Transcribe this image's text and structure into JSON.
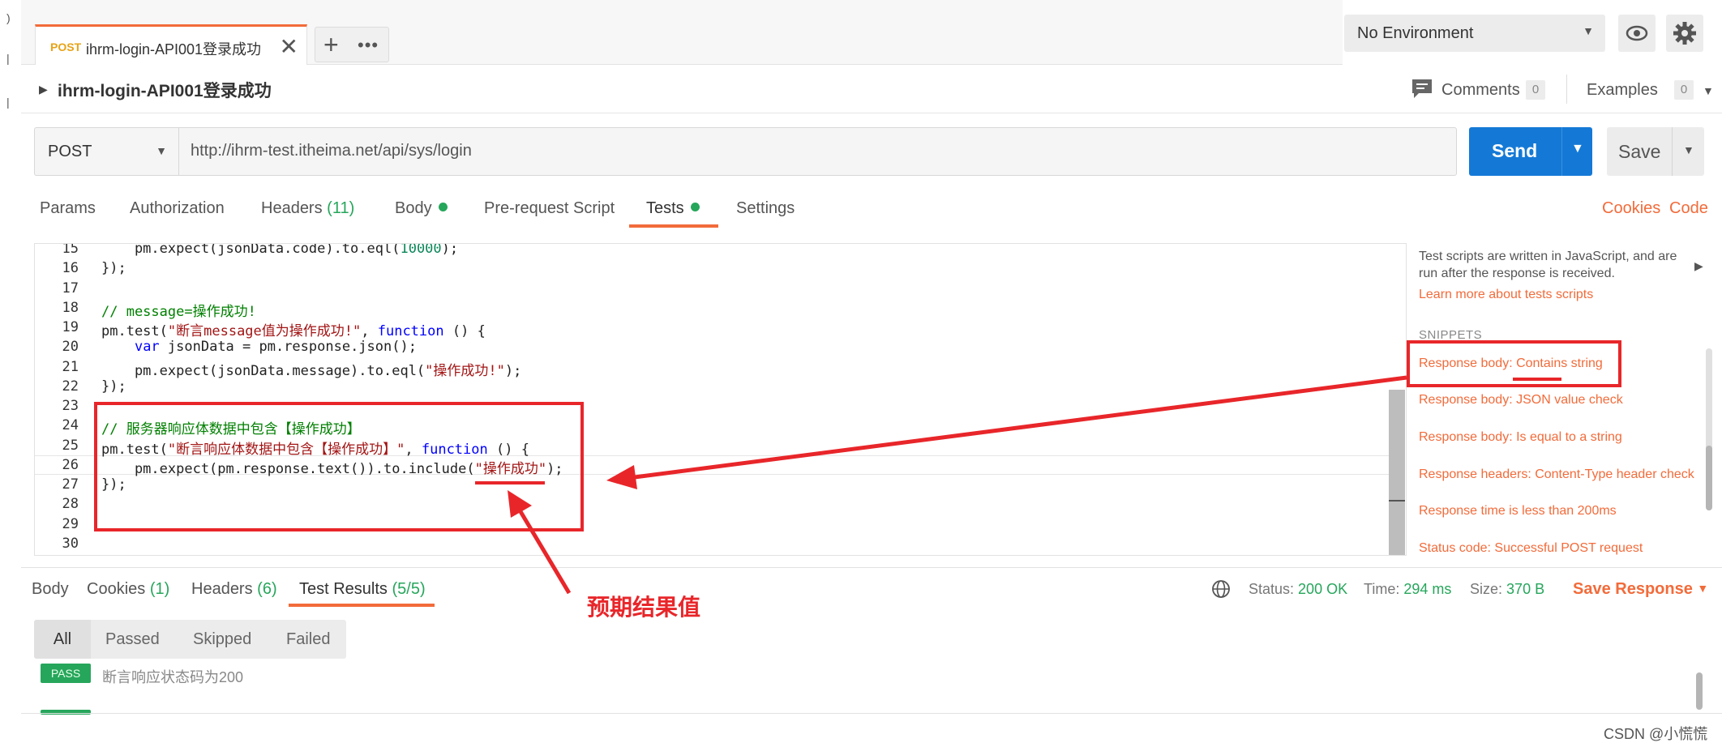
{
  "app": {
    "request_tab": {
      "method": "POST",
      "title": "ihrm-login-API001登录成功",
      "close": "✕"
    },
    "new_tab": "+",
    "more": "•••",
    "environment": "No Environment"
  },
  "request": {
    "name": "ihrm-login-API001登录成功",
    "comments_label": "Comments",
    "comments_count": "0",
    "examples_label": "Examples",
    "examples_count": "0",
    "method": "POST",
    "url": "http://ihrm-test.itheima.net/api/sys/login",
    "send_label": "Send",
    "save_label": "Save"
  },
  "request_tabs": {
    "params": "Params",
    "authorization": "Authorization",
    "headers": "Headers",
    "headers_count": "(11)",
    "body": "Body",
    "prerequest": "Pre-request Script",
    "tests": "Tests",
    "settings": "Settings",
    "cookies": "Cookies",
    "code": "Code"
  },
  "editor": {
    "line_numbers": [
      "15",
      "16",
      "17",
      "18",
      "19",
      "20",
      "21",
      "22",
      "23",
      "24",
      "25",
      "26",
      "27",
      "28",
      "29",
      "30"
    ],
    "lines": {
      "l15": [
        "    pm.expect(jsonData.code).to.eql(",
        "10000",
        ");"
      ],
      "l16": "});",
      "l18": "// message=操作成功!",
      "l19": [
        "pm.test(",
        "\"断言message值为操作成功!\"",
        ", ",
        "function",
        " () {"
      ],
      "l20": [
        "    ",
        "var",
        " jsonData = pm.response.json();"
      ],
      "l21": [
        "    pm.expect(jsonData.message).to.eql(",
        "\"操作成功!\"",
        ");"
      ],
      "l22": "});",
      "l24": "// 服务器响应体数据中包含【操作成功】",
      "l25": [
        "pm.test(",
        "\"断言响应体数据中包含【操作成功】\"",
        ", ",
        "function",
        " () {"
      ],
      "l26": [
        "    pm.expect(pm.response.text()).to.include(",
        "\"操作成功\"",
        ");"
      ],
      "l27": "});"
    }
  },
  "snippets": {
    "help": "Test scripts are written in JavaScript, and are run after the response is received.",
    "learn_more": "Learn more about tests scripts",
    "heading": "SNIPPETS",
    "items": [
      "Response body: Contains string",
      "Response body: JSON value check",
      "Response body: Is equal to a string",
      "Response headers: Content-Type header check",
      "Response time is less than 200ms",
      "Status code: Successful POST request"
    ]
  },
  "response": {
    "tabs": {
      "body": "Body",
      "cookies": "Cookies",
      "cookies_count": "(1)",
      "headers": "Headers",
      "headers_count": "(6)",
      "test_results": "Test Results",
      "test_results_count": "(5/5)"
    },
    "status_label": "Status:",
    "status_value": "200 OK",
    "time_label": "Time:",
    "time_value": "294 ms",
    "size_label": "Size:",
    "size_value": "370 B",
    "save_response": "Save Response",
    "filters": [
      "All",
      "Passed",
      "Skipped",
      "Failed"
    ],
    "results": [
      {
        "badge": "PASS",
        "text": "断言响应状态码为200"
      }
    ]
  },
  "annotation": {
    "label": "预期结果值",
    "color": "#e8262a"
  },
  "watermark": "CSDN @小慌慌",
  "colors": {
    "accent": "#f26b3a",
    "send": "#1479d6",
    "success": "#26a65b",
    "method_post": "#e8a317"
  }
}
